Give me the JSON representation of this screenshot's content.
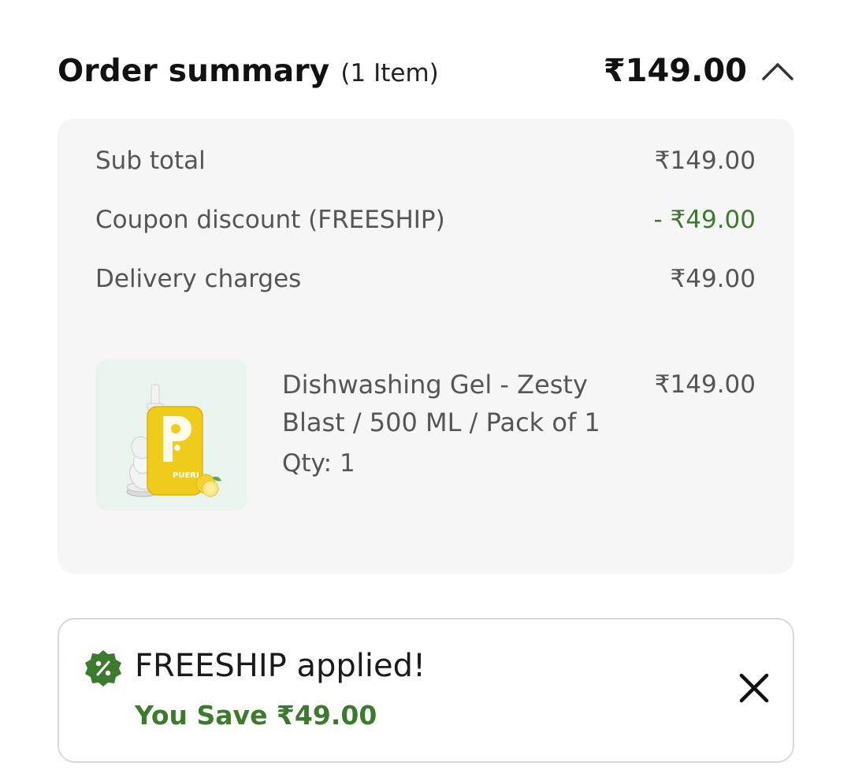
{
  "header": {
    "title": "Order summary",
    "item_count": "(1 Item)",
    "total": "₹149.00",
    "toggle_icon": "chevron-up-icon"
  },
  "summary": {
    "rows": [
      {
        "label": "Sub total",
        "value": "₹149.00"
      },
      {
        "label": "Coupon discount (FREESHIP)",
        "value": "- ₹49.00"
      },
      {
        "label": "Delivery charges",
        "value": "₹49.00"
      }
    ],
    "discount_color": "#3c7a2e"
  },
  "product": {
    "name": "Dishwashing Gel - Zesty Blast / 500 ML / Pack of 1",
    "qty": "Qty: 1",
    "price": "₹149.00",
    "image_brand": "PUERI"
  },
  "coupon": {
    "title": "FREESHIP applied!",
    "save_text": "You Save ₹49.00",
    "badge_icon": "discount-badge-icon",
    "close_icon": "close-icon",
    "accent": "#3c7a2e"
  }
}
